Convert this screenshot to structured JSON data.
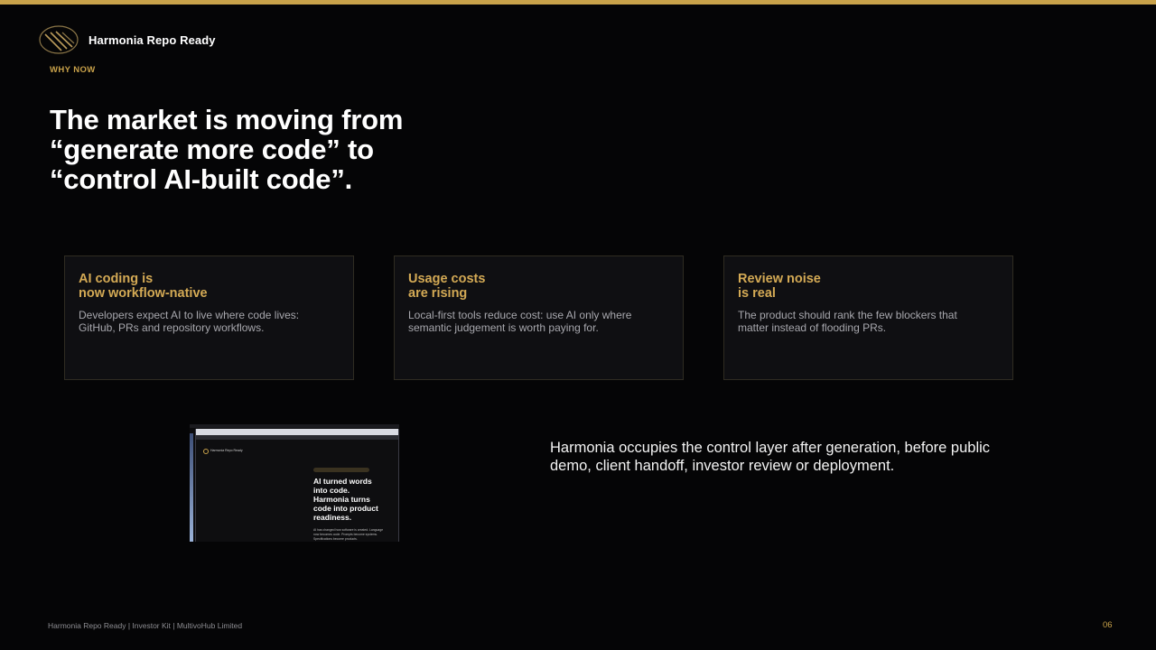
{
  "brand": {
    "name": "Harmonia Repo Ready"
  },
  "eyebrow": "WHY NOW",
  "headline": {
    "line1": "The market is moving from",
    "line2": "“generate more code” to",
    "line3": "“control AI-built code”."
  },
  "cards": [
    {
      "title1": "AI coding is",
      "title2": "now workflow-native",
      "body1": "Developers expect AI to live where code lives:",
      "body2": "GitHub, PRs and repository workflows."
    },
    {
      "title1": "Usage costs",
      "title2": "are rising",
      "body1": "Local-first tools reduce cost: use AI only where",
      "body2": "semantic judgement is worth paying for."
    },
    {
      "title1": "Review noise",
      "title2": "is real",
      "body1": "The product should rank the few blockers that",
      "body2": "matter instead of flooding PRs."
    }
  ],
  "screenshot": {
    "site_name": "Harmonia Repo Ready",
    "hero_line1": "AI turned words",
    "hero_line2": "into code.",
    "hero_line3": "Harmonia turns",
    "hero_line4": "code into product",
    "hero_line5": "readiness.",
    "paragraph": "AI has changed how software is created. Language now becomes code. Prompts become systems. Specifications become products."
  },
  "summary": {
    "line1": "Harmonia occupies the control layer after generation, before public",
    "line2": "demo, client handoff, investor review or deployment."
  },
  "footer": "Harmonia Repo Ready | Investor Kit | MultivoHub Limited",
  "page_number": "06",
  "colors": {
    "accent": "#c9a24a",
    "background": "#050506",
    "card": "#0f0f12"
  }
}
